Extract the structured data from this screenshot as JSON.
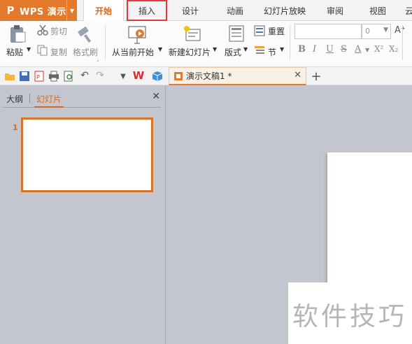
{
  "app": {
    "name": "WPS 演示",
    "logo_glyph": "P",
    "brand_color": "#e37a2b"
  },
  "menu": {
    "tabs": [
      "开始",
      "插入",
      "设计",
      "动画",
      "幻灯片放映",
      "审阅",
      "视图",
      "云"
    ],
    "active_tab": "开始",
    "highlighted_tab": "插入"
  },
  "ribbon": {
    "clipboard": {
      "paste": "粘贴",
      "cut": "剪切",
      "copy": "复制",
      "format_painter": "格式刷"
    },
    "slides": {
      "from_current": "从当前开始",
      "new_slide": "新建幻灯片",
      "layout": "版式",
      "reset": "重置",
      "section": "节"
    },
    "font": {
      "size_value": "0",
      "bold": "B",
      "italic": "I",
      "underline": "U",
      "strike": "S",
      "font_color": "A",
      "superscript": "X²",
      "subscript": "X₂",
      "grow": "A⁺"
    }
  },
  "document": {
    "tab_title": "演示文稿1 *"
  },
  "panel": {
    "tab_outline": "大纲",
    "tab_slides": "幻灯片",
    "slide_number": "1"
  },
  "watermark": {
    "text": "软件技巧"
  }
}
